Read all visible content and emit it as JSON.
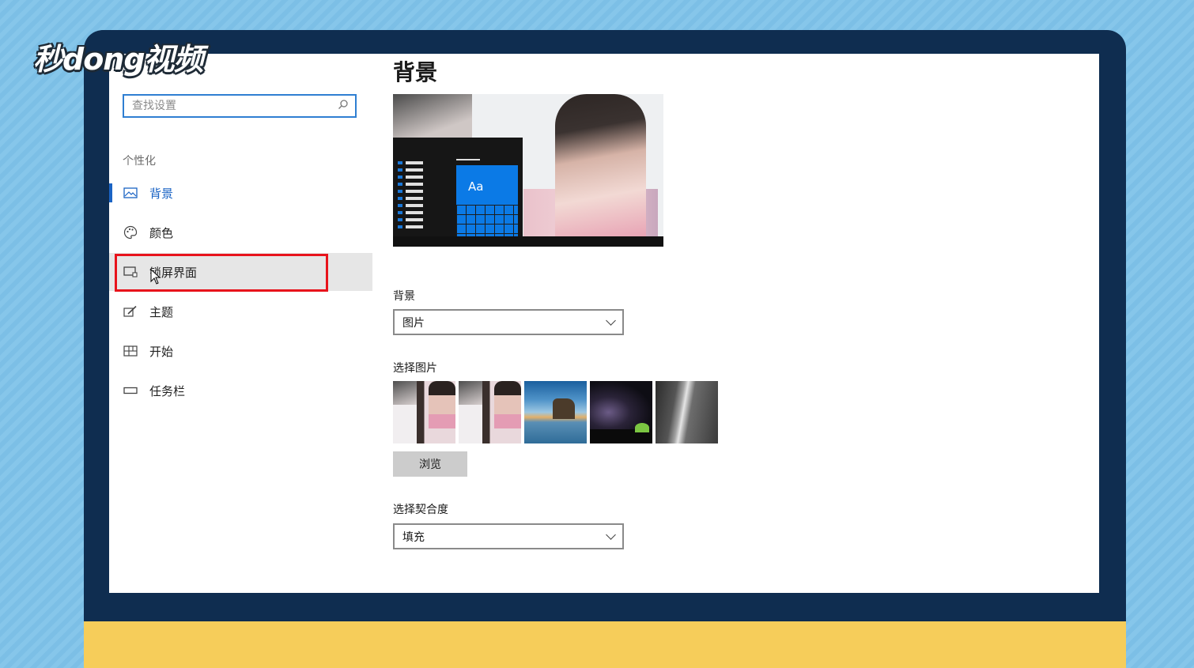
{
  "watermark": {
    "logo_text": "秒dong视频"
  },
  "sidebar": {
    "search_placeholder": "查找设置",
    "section": "个性化",
    "items": [
      {
        "label": "背景",
        "icon": "picture-icon"
      },
      {
        "label": "颜色",
        "icon": "palette-icon"
      },
      {
        "label": "锁屏界面",
        "icon": "lock-screen-icon"
      },
      {
        "label": "主题",
        "icon": "theme-brush-icon"
      },
      {
        "label": "开始",
        "icon": "start-grid-icon"
      },
      {
        "label": "任务栏",
        "icon": "taskbar-icon"
      }
    ]
  },
  "main": {
    "title": "背景",
    "preview_tile_text": "Aa",
    "background_label": "背景",
    "background_value": "图片",
    "choose_picture_label": "选择图片",
    "browse_label": "浏览",
    "fit_label": "选择契合度",
    "fit_value": "填充"
  },
  "colors": {
    "accent": "#1a63c4",
    "highlight_box": "#e8131b",
    "monitor": "#0f2d50",
    "stand": "#f6cd5a"
  }
}
